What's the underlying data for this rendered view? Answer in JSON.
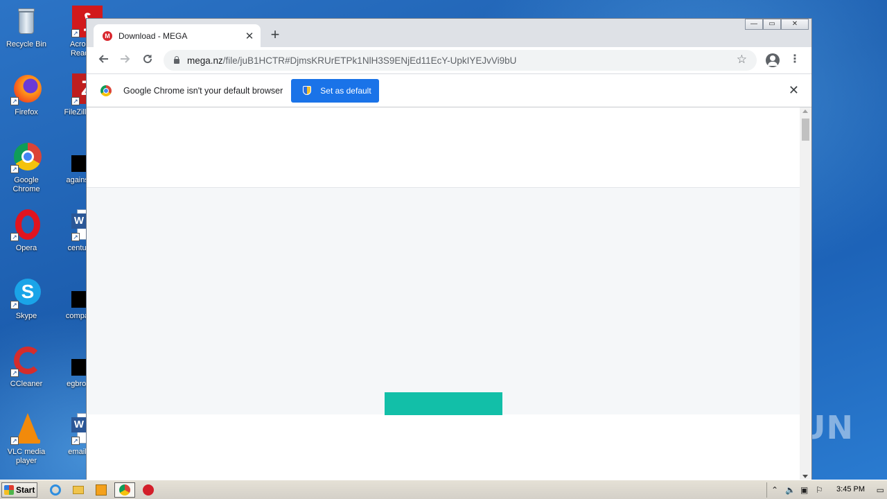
{
  "desktop": {
    "icons": [
      {
        "label": "Recycle Bin",
        "icon": "recycle-bin-icon"
      },
      {
        "label": "Acrobat Reader",
        "icon": "acrobat-icon"
      },
      {
        "label": "Firefox",
        "icon": "firefox-icon"
      },
      {
        "label": "FileZilla C",
        "icon": "filezilla-icon"
      },
      {
        "label": "Google Chrome",
        "icon": "chrome-icon"
      },
      {
        "label": "againsale",
        "icon": "file-icon"
      },
      {
        "label": "Opera",
        "icon": "opera-icon"
      },
      {
        "label": "centuryst",
        "icon": "word-icon"
      },
      {
        "label": "Skype",
        "icon": "skype-icon"
      },
      {
        "label": "companys",
        "icon": "file-icon"
      },
      {
        "label": "CCleaner",
        "icon": "ccleaner-icon"
      },
      {
        "label": "egbrowse",
        "icon": "file-icon"
      },
      {
        "label": "VLC media player",
        "icon": "vlc-icon"
      },
      {
        "label": "emailkey",
        "icon": "word-icon"
      }
    ],
    "watermark": "ANY RUN"
  },
  "browser": {
    "tab": {
      "title": "Download - MEGA",
      "favicon": "M"
    },
    "new_tab_label": "+",
    "window_controls": {
      "minimize": "—",
      "restore": "▭",
      "close": "✕"
    },
    "url": {
      "host": "mega.nz",
      "path": "/file/juB1HCTR#DjmsKRUrETPk1NlH3S9ENjEd11EcY-UpkIYEJvVi9bU"
    },
    "infobar": {
      "message": "Google Chrome isn't your default browser",
      "button_label": "Set as default",
      "close": "✕"
    }
  },
  "taskbar": {
    "start_label": "Start",
    "clock": "3:45 PM"
  }
}
